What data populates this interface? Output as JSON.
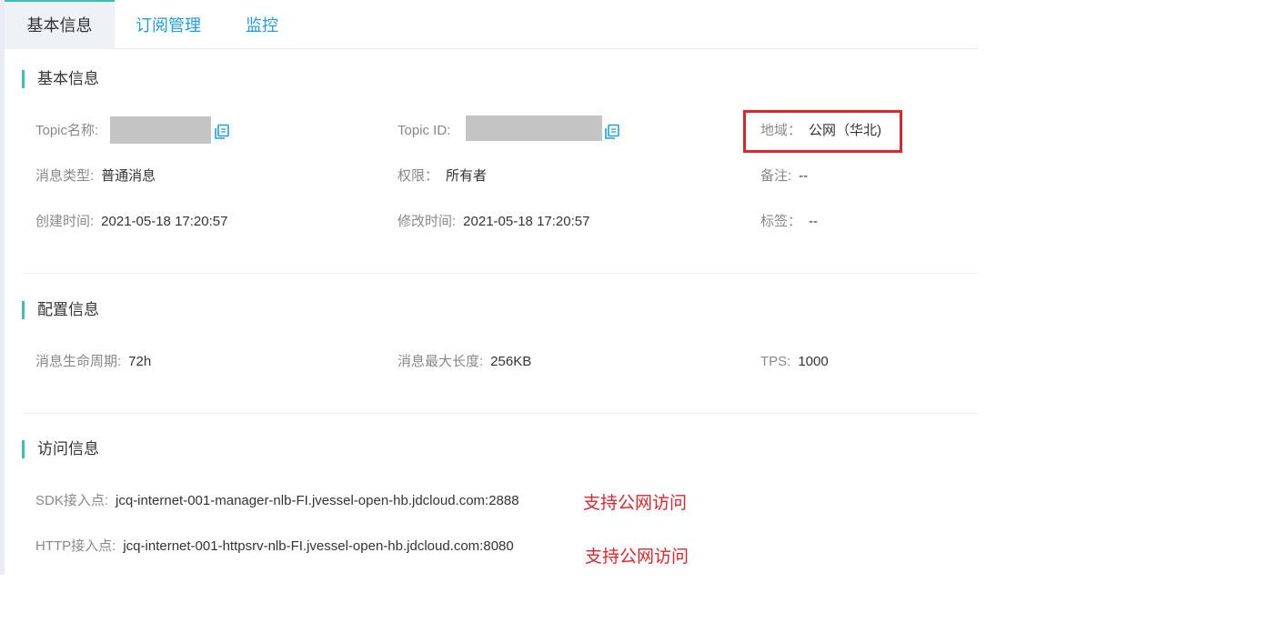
{
  "tabs": [
    {
      "label": "基本信息"
    },
    {
      "label": "订阅管理"
    },
    {
      "label": "监控"
    }
  ],
  "basic": {
    "title": "基本信息",
    "topic_name_label": "Topic名称:",
    "topic_id_label": "Topic ID:",
    "region_label": "地域：",
    "region_value": "公网（华北)",
    "msg_type_label": "消息类型:",
    "msg_type_value": "普通消息",
    "permission_label": "权限：",
    "permission_value": "所有者",
    "remark_label": "备注:",
    "remark_value": "--",
    "created_label": "创建时间:",
    "created_value": "2021-05-18 17:20:57",
    "modified_label": "修改时间:",
    "modified_value": "2021-05-18 17:20:57",
    "tags_label": "标签：",
    "tags_value": "--"
  },
  "config": {
    "title": "配置信息",
    "lifecycle_label": "消息生命周期:",
    "lifecycle_value": "72h",
    "maxlen_label": "消息最大长度:",
    "maxlen_value": "256KB",
    "tps_label": "TPS:",
    "tps_value": "1000"
  },
  "access": {
    "title": "访问信息",
    "sdk_label": "SDK接入点:",
    "sdk_value": "jcq-internet-001-manager-nlb-FI.jvessel-open-hb.jdcloud.com:2888",
    "sdk_note": "支持公网访问",
    "http_label": "HTTP接入点:",
    "http_value": "jcq-internet-001-httpsrv-nlb-FI.jvessel-open-hb.jdcloud.com:8080",
    "http_note": "支持公网访问"
  },
  "colors": {
    "accent": "#3cc0b5",
    "link": "#1e9de6",
    "annotation": "#e0242b"
  },
  "icons": [
    "copy-icon"
  ]
}
